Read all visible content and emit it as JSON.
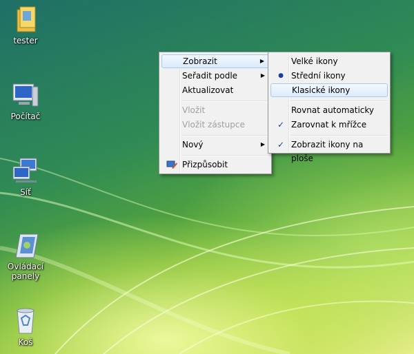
{
  "desktop": {
    "icons": [
      {
        "label": "tester"
      },
      {
        "label": "Počítač"
      },
      {
        "label": "Síť"
      },
      {
        "label": "Ovládací panely"
      },
      {
        "label": "Koš"
      }
    ]
  },
  "context_menu": {
    "items": [
      {
        "label": "Zobrazit",
        "submenu": true,
        "highlighted": true
      },
      {
        "label": "Seřadit podle",
        "submenu": true
      },
      {
        "label": "Aktualizovat"
      },
      {
        "label": "Vložit",
        "disabled": true
      },
      {
        "label": "Vložit zástupce",
        "disabled": true
      },
      {
        "label": "Nový",
        "submenu": true
      },
      {
        "label": "Přizpůsobit",
        "icon": "personalize-icon"
      }
    ],
    "arrow_glyph": "▶"
  },
  "view_submenu": {
    "items": [
      {
        "label": "Velké ikony"
      },
      {
        "label": "Střední ikony",
        "mark": "●",
        "selected": true
      },
      {
        "label": "Klasické ikony",
        "highlighted": true
      },
      {
        "label": "Rovnat automaticky"
      },
      {
        "label": "Zarovnat k mřížce",
        "mark": "✓",
        "checked": true
      },
      {
        "label": "Zobrazit ikony na ploše",
        "mark": "✓",
        "checked": true
      }
    ]
  },
  "colors": {
    "menu_bg": "#f1f1f1",
    "highlight": "#dcebfb",
    "check": "#1a3f9a"
  }
}
